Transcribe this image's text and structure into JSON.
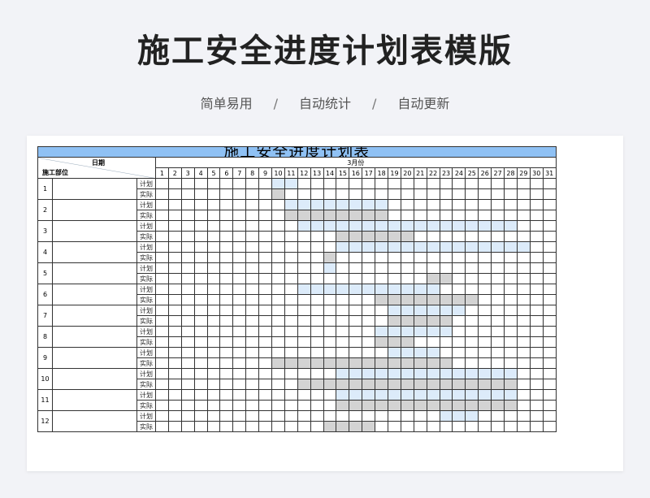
{
  "header": {
    "title": "施工安全进度计划表模版",
    "features": [
      "简单易用",
      "自动统计",
      "自动更新"
    ],
    "separator": "/"
  },
  "sheet": {
    "title": "施工安全进度计划表",
    "corner_top": "日期",
    "corner_bottom": "施工部位",
    "month": "3月份",
    "plan_label": "计划",
    "actual_label": "实际",
    "colors": {
      "title_bg": "#8fc1f4",
      "plan": "#dcebfa",
      "actual": "#d3d3d3"
    },
    "days": [
      1,
      2,
      3,
      4,
      5,
      6,
      7,
      8,
      9,
      10,
      11,
      12,
      13,
      14,
      15,
      16,
      17,
      18,
      19,
      20,
      21,
      22,
      23,
      24,
      25,
      26,
      27,
      28,
      29,
      30,
      31
    ],
    "rows": [
      {
        "no": "1",
        "plan": [
          10,
          11
        ],
        "actual": [
          10
        ]
      },
      {
        "no": "2",
        "plan": [
          11,
          18
        ],
        "actual": [
          11,
          18
        ]
      },
      {
        "no": "3",
        "plan": [
          12,
          28
        ],
        "actual": [
          15,
          20
        ]
      },
      {
        "no": "4",
        "plan": [
          15,
          29
        ],
        "actual": [
          14
        ]
      },
      {
        "no": "5",
        "plan": [
          14
        ],
        "actual": [
          22,
          23
        ]
      },
      {
        "no": "6",
        "plan": [
          12,
          22
        ],
        "actual": [
          18,
          25
        ]
      },
      {
        "no": "7",
        "plan": [
          19,
          24
        ],
        "actual": [
          19,
          23
        ]
      },
      {
        "no": "8",
        "plan": [
          18,
          23
        ],
        "actual": [
          18,
          20
        ]
      },
      {
        "no": "9",
        "plan": [
          19,
          22
        ],
        "actual": [
          10,
          23
        ]
      },
      {
        "no": "10",
        "plan": [
          15,
          28
        ],
        "actual": [
          12,
          28
        ]
      },
      {
        "no": "11",
        "plan": [
          15,
          28
        ],
        "actual": [
          15,
          28
        ]
      },
      {
        "no": "12",
        "plan": [
          23,
          25
        ],
        "actual": [
          14,
          17
        ]
      }
    ]
  }
}
